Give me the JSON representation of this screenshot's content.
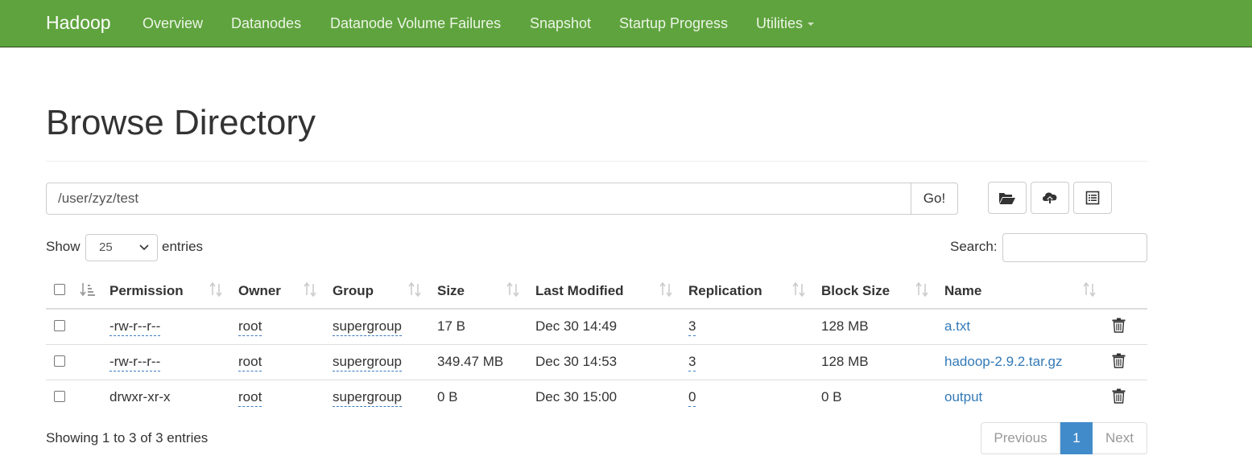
{
  "navbar": {
    "brand": "Hadoop",
    "items": [
      "Overview",
      "Datanodes",
      "Datanode Volume Failures",
      "Snapshot",
      "Startup Progress",
      "Utilities"
    ]
  },
  "page": {
    "title": "Browse Directory"
  },
  "path_bar": {
    "value": "/user/zyz/test",
    "go_label": "Go!"
  },
  "toolbar_icons": [
    "folder-open-icon",
    "cloud-upload-icon",
    "list-alt-icon"
  ],
  "table_controls": {
    "show_label": "Show",
    "page_length": "25",
    "entries_label": "entries",
    "search_label": "Search:",
    "search_value": ""
  },
  "table": {
    "columns": [
      "Permission",
      "Owner",
      "Group",
      "Size",
      "Last Modified",
      "Replication",
      "Block Size",
      "Name"
    ],
    "rows": [
      {
        "permission": "-rw-r--r--",
        "owner": "root",
        "group": "supergroup",
        "size": "17 B",
        "modified": "Dec 30 14:49",
        "replication": "3",
        "block_size": "128 MB",
        "name": "a.txt"
      },
      {
        "permission": "-rw-r--r--",
        "owner": "root",
        "group": "supergroup",
        "size": "349.47 MB",
        "modified": "Dec 30 14:53",
        "replication": "3",
        "block_size": "128 MB",
        "name": "hadoop-2.9.2.tar.gz"
      },
      {
        "permission": "drwxr-xr-x",
        "owner": "root",
        "group": "supergroup",
        "size": "0 B",
        "modified": "Dec 30 15:00",
        "replication": "0",
        "block_size": "0 B",
        "name": "output"
      }
    ]
  },
  "footer": {
    "info": "Showing 1 to 3 of 3 entries",
    "previous": "Previous",
    "current_page": "1",
    "next": "Next"
  },
  "colors": {
    "navbar_bg": "#5fa33e",
    "link": "#337ab7",
    "active_page": "#428bca"
  }
}
